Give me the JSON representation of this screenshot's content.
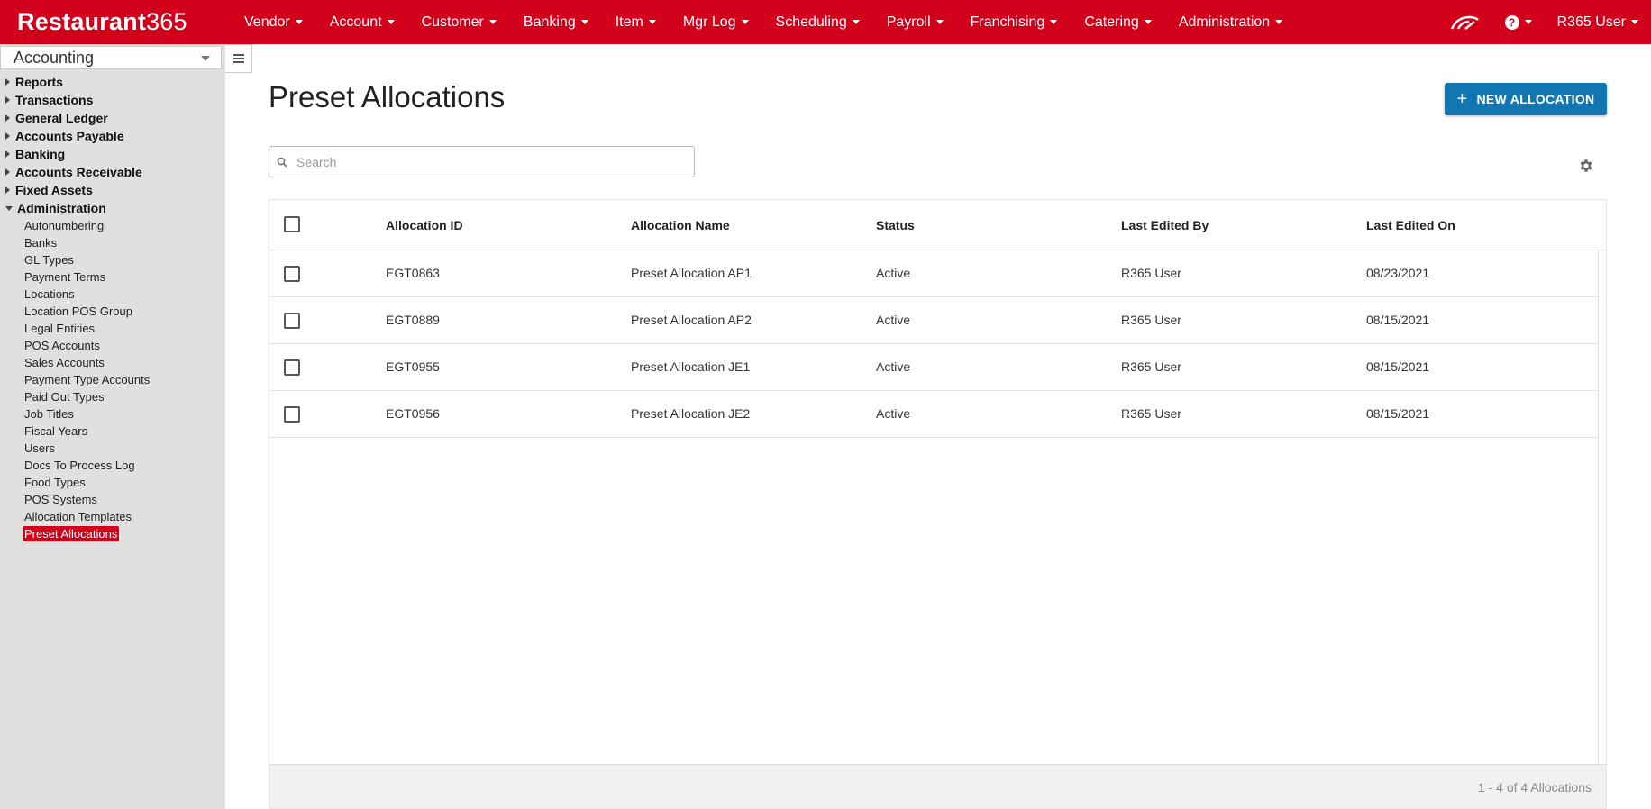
{
  "brand": {
    "logo_bold": "Restaurant",
    "logo_light": "365",
    "color": "#d3001b"
  },
  "nav": [
    {
      "label": "Vendor"
    },
    {
      "label": "Account"
    },
    {
      "label": "Customer"
    },
    {
      "label": "Banking"
    },
    {
      "label": "Item"
    },
    {
      "label": "Mgr Log"
    },
    {
      "label": "Scheduling"
    },
    {
      "label": "Payroll"
    },
    {
      "label": "Franchising"
    },
    {
      "label": "Catering"
    },
    {
      "label": "Administration"
    }
  ],
  "topright": {
    "user": "R365 User",
    "dashboard_icon": "speedometer-icon",
    "help_icon": "help-icon"
  },
  "sidebar": {
    "module": "Accounting",
    "sections": [
      {
        "label": "Reports"
      },
      {
        "label": "Transactions"
      },
      {
        "label": "General Ledger"
      },
      {
        "label": "Accounts Payable"
      },
      {
        "label": "Banking"
      },
      {
        "label": "Accounts Receivable"
      },
      {
        "label": "Fixed Assets"
      },
      {
        "label": "Administration"
      }
    ],
    "admin_items": [
      "Autonumbering",
      "Banks",
      "GL Types",
      "Payment Terms",
      "Locations",
      "Location POS Group",
      "Legal Entities",
      "POS Accounts",
      "Sales Accounts",
      "Payment Type Accounts",
      "Paid Out Types",
      "Job Titles",
      "Fiscal Years",
      "Users",
      "Docs To Process Log",
      "Food Types",
      "POS Systems",
      "Allocation Templates",
      "Preset Allocations"
    ],
    "active_item": "Preset Allocations"
  },
  "page": {
    "title": "Preset Allocations",
    "new_button": "NEW ALLOCATION",
    "accent": "#1276b3",
    "search_placeholder": "Search"
  },
  "table": {
    "columns": [
      "Allocation ID",
      "Allocation Name",
      "Status",
      "Last Edited By",
      "Last Edited On"
    ],
    "rows": [
      {
        "id": "EGT0863",
        "name": "Preset Allocation AP1",
        "status": "Active",
        "by": "R365 User",
        "on": "08/23/2021"
      },
      {
        "id": "EGT0889",
        "name": "Preset Allocation AP2",
        "status": "Active",
        "by": "R365 User",
        "on": "08/15/2021"
      },
      {
        "id": "EGT0955",
        "name": "Preset Allocation JE1",
        "status": "Active",
        "by": "R365 User",
        "on": "08/15/2021"
      },
      {
        "id": "EGT0956",
        "name": "Preset Allocation JE2",
        "status": "Active",
        "by": "R365 User",
        "on": "08/15/2021"
      }
    ],
    "footer": "1 - 4 of 4 Allocations"
  }
}
